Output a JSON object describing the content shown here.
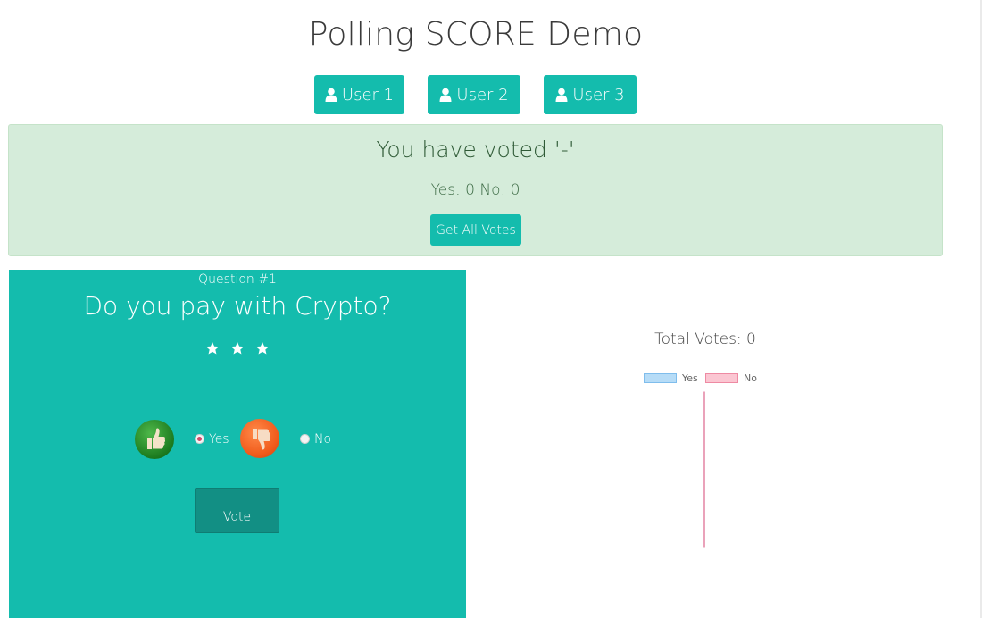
{
  "page": {
    "title": "Polling SCORE Demo"
  },
  "users": [
    {
      "label": "User 1"
    },
    {
      "label": "User 2"
    },
    {
      "label": "User 3"
    }
  ],
  "status": {
    "voted_text": "You have voted '-'",
    "counts_text": "Yes: 0 No: 0",
    "get_votes_label": "Get All Votes"
  },
  "question": {
    "number": "Question #1",
    "text": "Do you pay with Crypto?",
    "stars": 3,
    "options": [
      {
        "label": "Yes",
        "selected": true
      },
      {
        "label": "No",
        "selected": false
      }
    ],
    "vote_label": "Vote"
  },
  "icons": {
    "user": "user-icon",
    "star": "star-icon",
    "thumb_up": "thumbs-up-icon",
    "thumb_down": "thumbs-down-icon"
  },
  "colors": {
    "accent": "#14bcad",
    "alert_bg": "#d5ecda",
    "vote_button": "#128f84",
    "yes_series": "#9fd0f5",
    "no_series": "#f6a5b8"
  },
  "chart_data": {
    "type": "pie",
    "title": "Total Votes: 0",
    "legend": [
      "Yes",
      "No"
    ],
    "series": [
      {
        "name": "Yes",
        "value": 0
      },
      {
        "name": "No",
        "value": 0
      }
    ],
    "legend_position": "top"
  }
}
